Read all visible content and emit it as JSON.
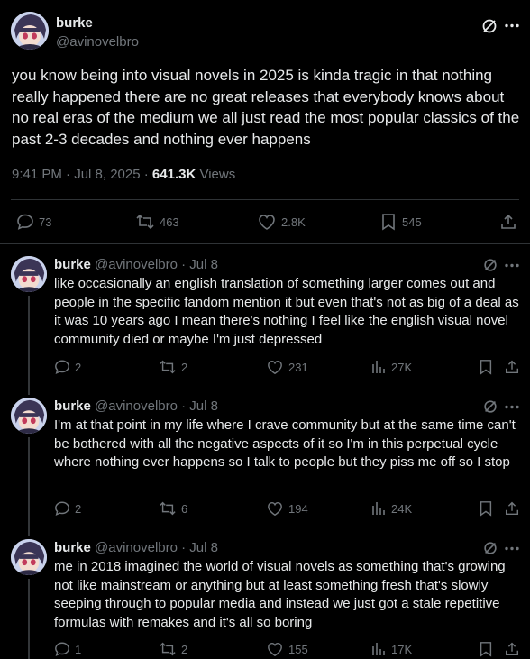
{
  "main_post": {
    "display_name": "burke",
    "handle": "@avinovelbro",
    "text": "you know being into visual novels in 2025 is kinda tragic in that nothing really happened there are no great releases that everybody knows about no real eras of the medium we all just read the most popular classics of the past 2-3 decades and nothing ever happens",
    "time": "9:41 PM · Jul 8, 2025 · ",
    "views_count": "641.3K",
    "views_label": " Views",
    "replies": "73",
    "reposts": "463",
    "likes": "2.8K",
    "bookmarks": "545"
  },
  "replies": [
    {
      "display_name": "burke",
      "handle": "@avinovelbro · Jul 8",
      "text": "like occasionally an english translation of something larger comes out and people in the specific fandom mention it but even that's not as big of a deal as it was 10 years ago I mean there's nothing I feel like the english visual novel community died or maybe I'm just depressed",
      "replies": "2",
      "reposts": "2",
      "likes": "231",
      "views": "27K"
    },
    {
      "display_name": "burke",
      "handle": "@avinovelbro · Jul 8",
      "text": "I'm at that point in my life where I crave community but at the same time can't be bothered with all the negative aspects of it so I'm in this perpetual cycle where nothing ever happens so I talk to people but they piss me off so I stop",
      "replies": "2",
      "reposts": "6",
      "likes": "194",
      "views": "24K"
    },
    {
      "display_name": "burke",
      "handle": "@avinovelbro · Jul 8",
      "text": "me in 2018 imagined the world of visual novels as something that's growing not like mainstream or anything but at least something fresh that's slowly seeping through to popular media and instead we just got a stale repetitive formulas with remakes and it's all so boring",
      "replies": "1",
      "reposts": "2",
      "likes": "155",
      "views": "17K"
    }
  ],
  "icons": {
    "grok": "grok-icon",
    "more": "more-icon",
    "reply": "reply-icon",
    "repost": "repost-icon",
    "like": "like-icon",
    "views": "views-icon",
    "bookmark": "bookmark-icon",
    "share": "share-icon"
  },
  "colors": {
    "background": "#000000",
    "text": "#e7e9ea",
    "muted": "#71767b",
    "divider": "#2f3336"
  }
}
